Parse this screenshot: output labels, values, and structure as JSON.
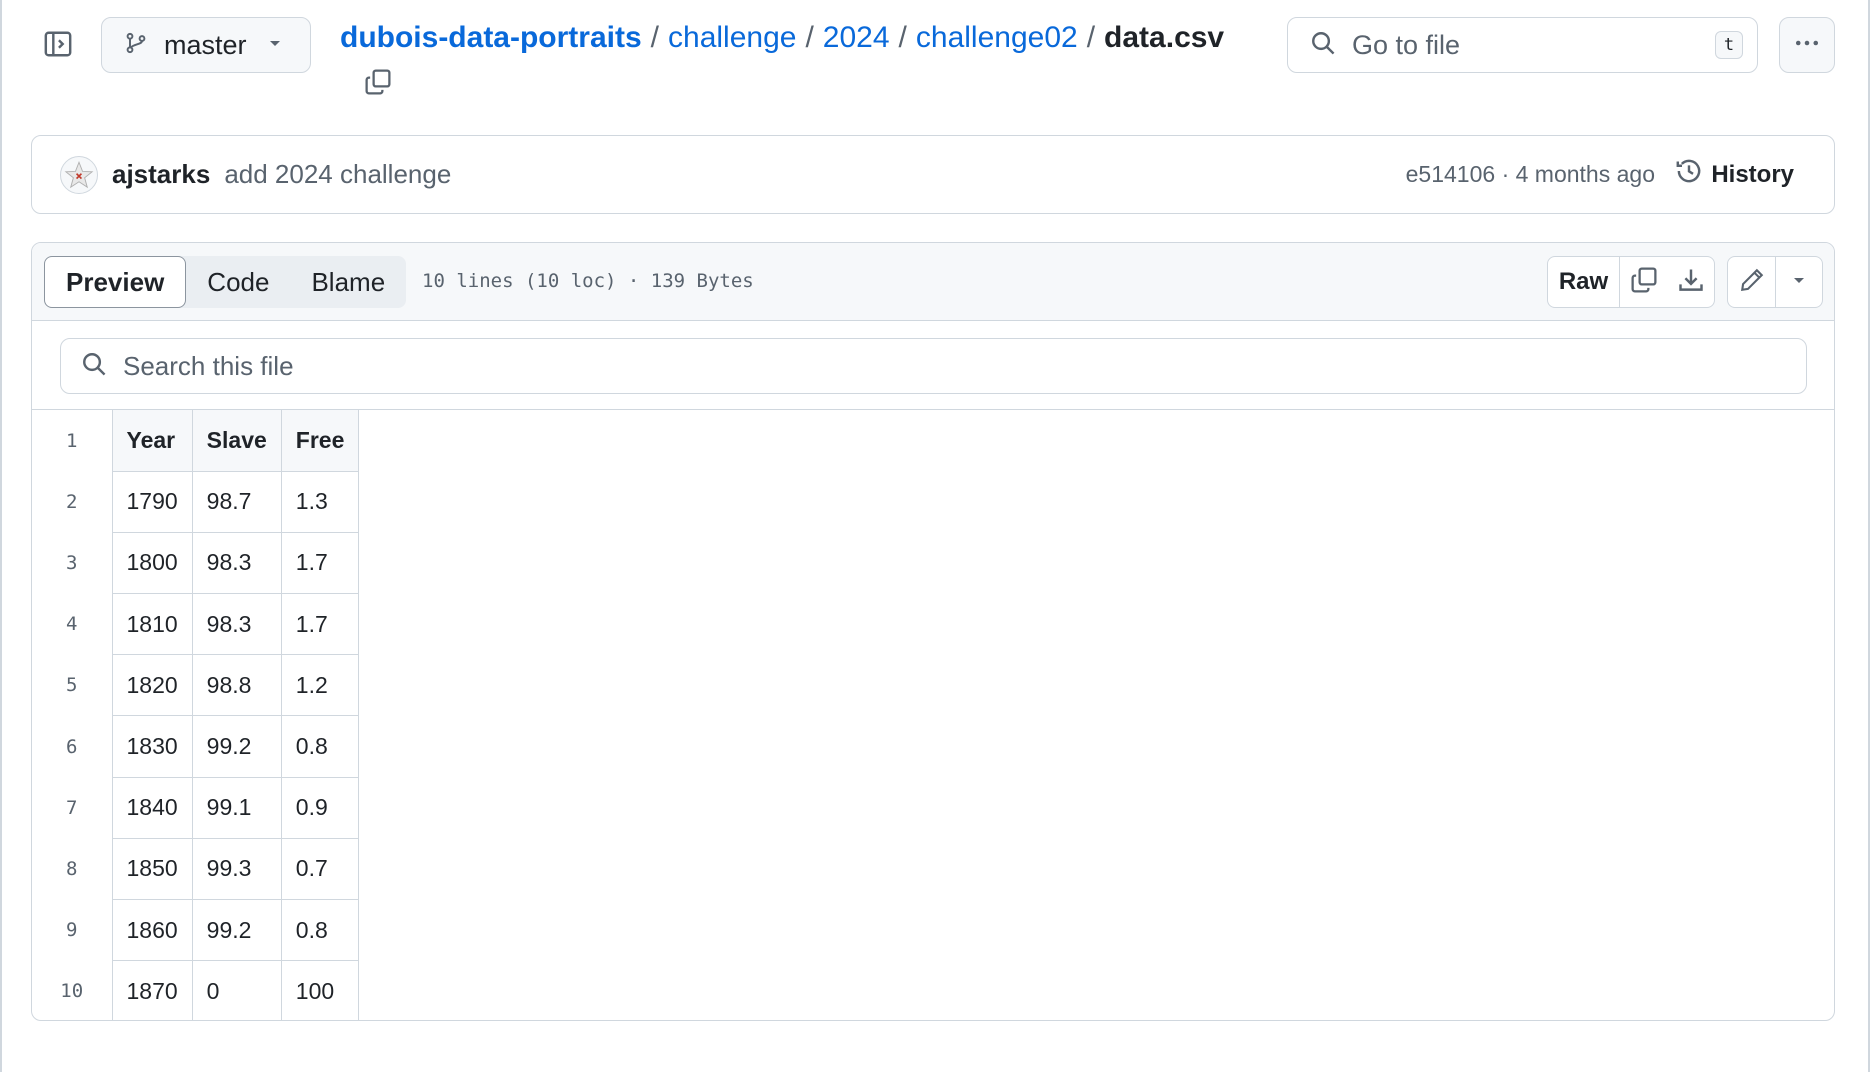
{
  "header": {
    "branch": "master",
    "breadcrumb": {
      "repo": "dubois-data-portraits",
      "parts": [
        "challenge",
        "2024",
        "challenge02"
      ],
      "file": "data.csv",
      "separator": "/"
    },
    "go_to_file": {
      "placeholder": "Go to file",
      "shortcut": "t"
    }
  },
  "commit": {
    "author": "ajstarks",
    "message": "add 2024 challenge",
    "meta": "e514106 · 4 months ago",
    "history_label": "History"
  },
  "file_view": {
    "tabs": [
      {
        "label": "Preview",
        "active": true
      },
      {
        "label": "Code",
        "active": false
      },
      {
        "label": "Blame",
        "active": false
      }
    ],
    "info": "10 lines (10 loc) · 139 Bytes",
    "raw_label": "Raw",
    "search_placeholder": "Search this file"
  },
  "csv": {
    "columns": [
      "Year",
      "Slave",
      "Free"
    ],
    "rows": [
      [
        "1790",
        "98.7",
        "1.3"
      ],
      [
        "1800",
        "98.3",
        "1.7"
      ],
      [
        "1810",
        "98.3",
        "1.7"
      ],
      [
        "1820",
        "98.8",
        "1.2"
      ],
      [
        "1830",
        "99.2",
        "0.8"
      ],
      [
        "1840",
        "99.1",
        "0.9"
      ],
      [
        "1850",
        "99.3",
        "0.7"
      ],
      [
        "1860",
        "99.2",
        "0.8"
      ],
      [
        "1870",
        "0",
        "100"
      ]
    ],
    "line_numbers": [
      "1",
      "2",
      "3",
      "4",
      "5",
      "6",
      "7",
      "8",
      "9",
      "10"
    ]
  },
  "colors": {
    "link": "#0969da",
    "border": "#d0d7de",
    "muted": "#59636e",
    "header_bg": "#f6f8fa"
  }
}
